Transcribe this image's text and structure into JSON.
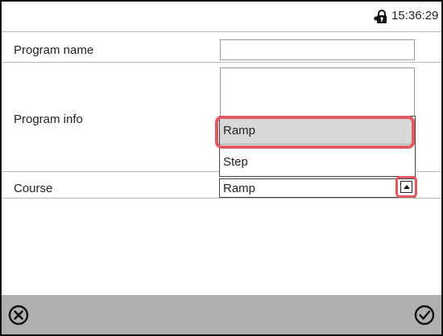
{
  "status_bar": {
    "time": "15:36:29",
    "lock_icon": "lock-key-icon"
  },
  "form": {
    "program_name": {
      "label": "Program name",
      "value": ""
    },
    "program_info": {
      "label": "Program info",
      "value": ""
    },
    "course": {
      "label": "Course",
      "selected": "Ramp",
      "options": [
        "Ramp",
        "Step"
      ],
      "highlighted_option": "Ramp"
    }
  },
  "bottom_bar": {
    "cancel_icon": "cancel-circle-x-icon",
    "confirm_icon": "confirm-check-icon"
  },
  "colors": {
    "highlight": "#e05a62",
    "bottom_bar": "#b0b0b0",
    "selected_option": "#d8d8d8"
  }
}
